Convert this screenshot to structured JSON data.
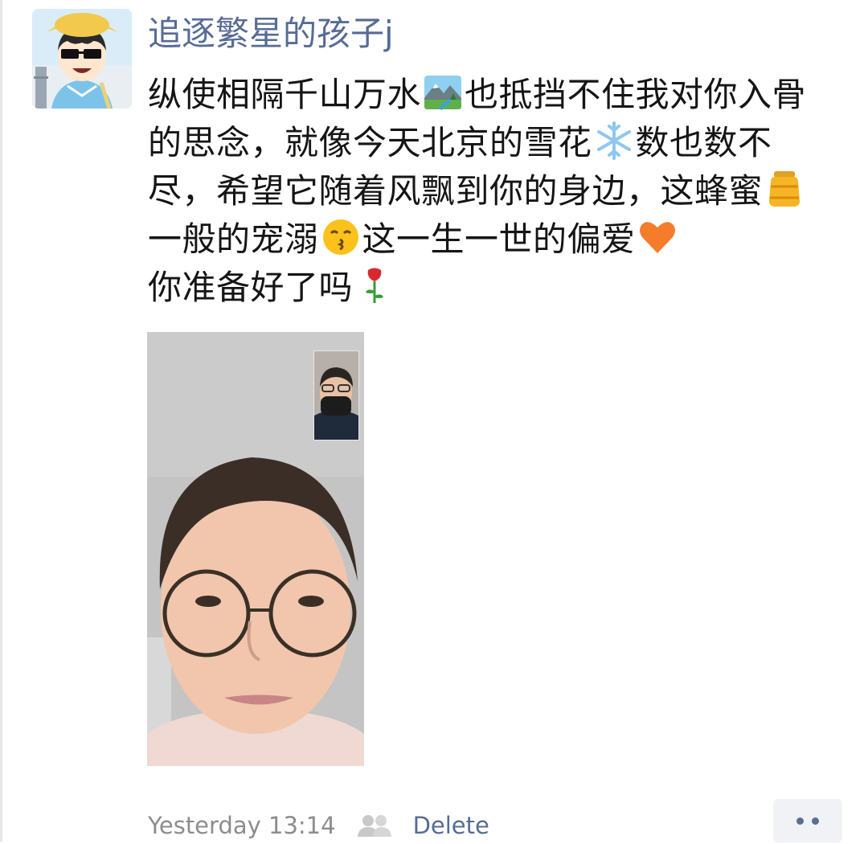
{
  "post": {
    "username": "追逐繁星的孩子j",
    "content_parts": [
      "纵使相隔千山万水",
      "也抵挡不住我对你入骨的思念，就像今天北京的雪花",
      "数也数不尽，希望它随着风飘到你的身边，这蜂蜜",
      "一般的宠溺",
      "这一生一世的偏爱",
      "你准备好了吗"
    ],
    "emojis": [
      "landscape-icon",
      "snowflake-icon",
      "honey-pot-icon",
      "kissing-face-icon",
      "orange-heart-icon",
      "rose-icon"
    ],
    "timestamp": "Yesterday 13:14",
    "privacy_icon": "friends-visibility-icon",
    "delete_label": "Delete",
    "more_icon": "more-dots-icon"
  },
  "colors": {
    "link": "#576b95",
    "text": "#151515",
    "muted": "#8d8d8d"
  }
}
